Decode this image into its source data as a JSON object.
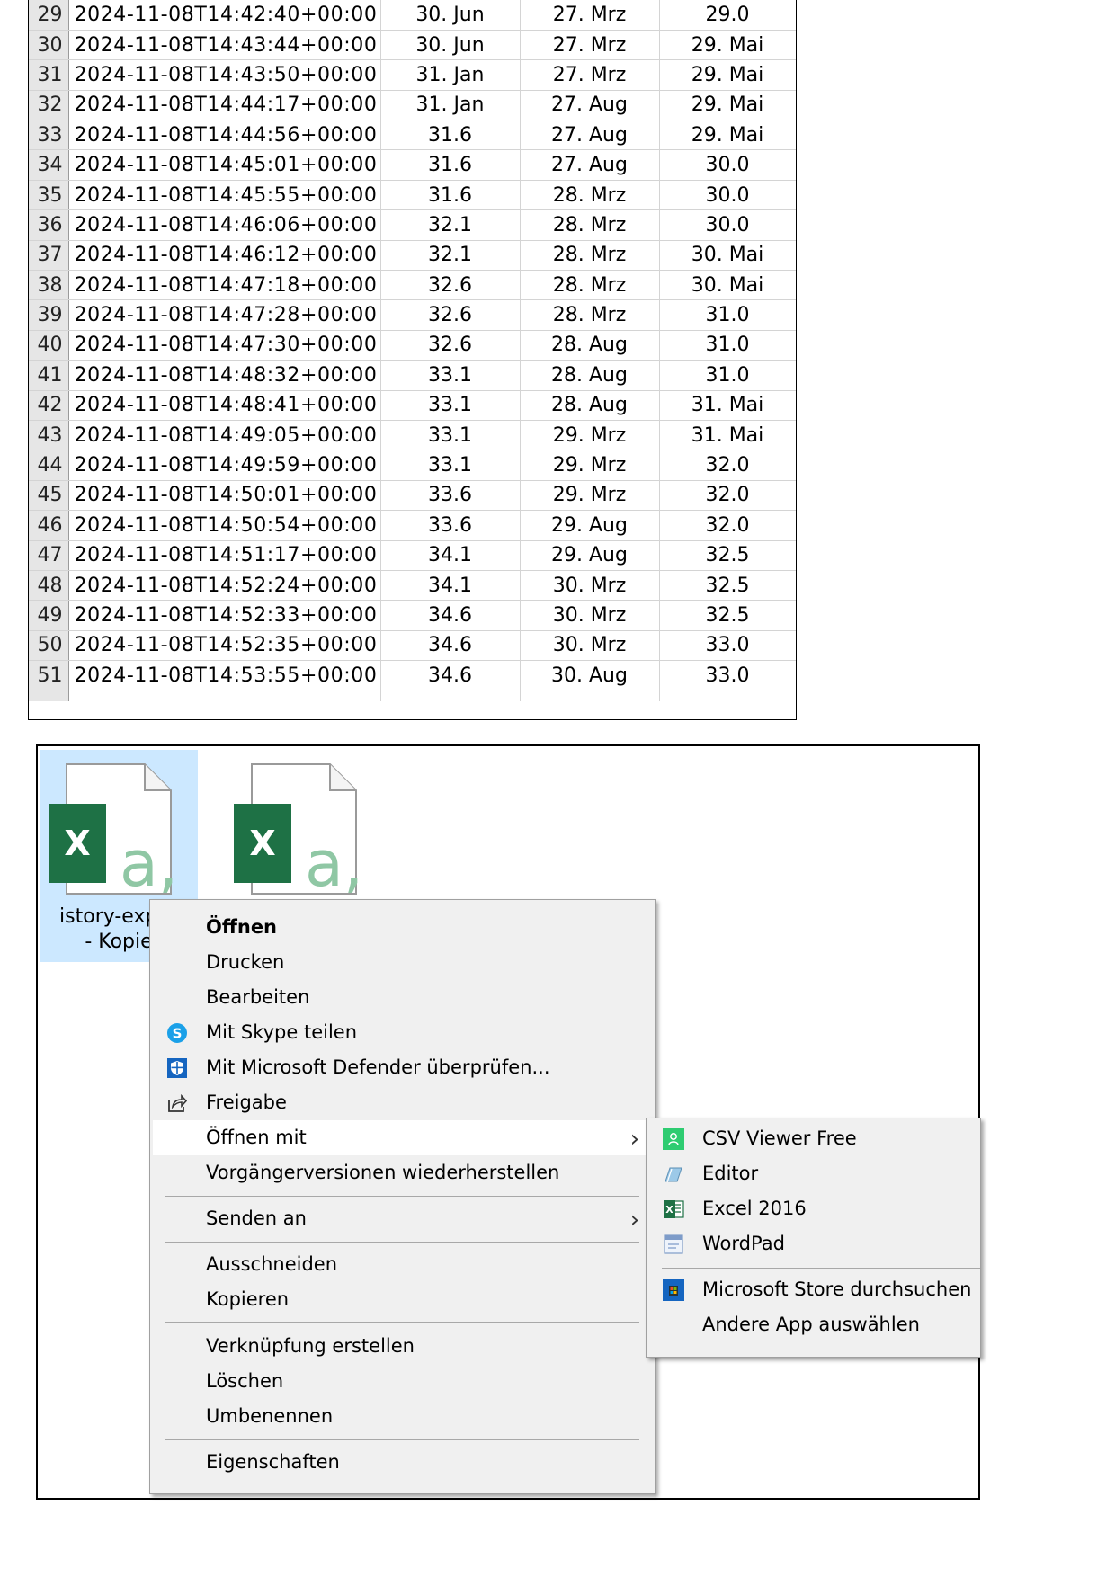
{
  "sheet": {
    "rows": [
      {
        "n": "29",
        "ts": "2024-11-08T14:42:40+00:00",
        "a": "30. Jun",
        "b": "27. Mrz",
        "c": "29.0"
      },
      {
        "n": "30",
        "ts": "2024-11-08T14:43:44+00:00",
        "a": "30. Jun",
        "b": "27. Mrz",
        "c": "29. Mai"
      },
      {
        "n": "31",
        "ts": "2024-11-08T14:43:50+00:00",
        "a": "31. Jan",
        "b": "27. Mrz",
        "c": "29. Mai"
      },
      {
        "n": "32",
        "ts": "2024-11-08T14:44:17+00:00",
        "a": "31. Jan",
        "b": "27. Aug",
        "c": "29. Mai"
      },
      {
        "n": "33",
        "ts": "2024-11-08T14:44:56+00:00",
        "a": "31.6",
        "b": "27. Aug",
        "c": "29. Mai"
      },
      {
        "n": "34",
        "ts": "2024-11-08T14:45:01+00:00",
        "a": "31.6",
        "b": "27. Aug",
        "c": "30.0"
      },
      {
        "n": "35",
        "ts": "2024-11-08T14:45:55+00:00",
        "a": "31.6",
        "b": "28. Mrz",
        "c": "30.0"
      },
      {
        "n": "36",
        "ts": "2024-11-08T14:46:06+00:00",
        "a": "32.1",
        "b": "28. Mrz",
        "c": "30.0"
      },
      {
        "n": "37",
        "ts": "2024-11-08T14:46:12+00:00",
        "a": "32.1",
        "b": "28. Mrz",
        "c": "30. Mai"
      },
      {
        "n": "38",
        "ts": "2024-11-08T14:47:18+00:00",
        "a": "32.6",
        "b": "28. Mrz",
        "c": "30. Mai"
      },
      {
        "n": "39",
        "ts": "2024-11-08T14:47:28+00:00",
        "a": "32.6",
        "b": "28. Mrz",
        "c": "31.0"
      },
      {
        "n": "40",
        "ts": "2024-11-08T14:47:30+00:00",
        "a": "32.6",
        "b": "28. Aug",
        "c": "31.0"
      },
      {
        "n": "41",
        "ts": "2024-11-08T14:48:32+00:00",
        "a": "33.1",
        "b": "28. Aug",
        "c": "31.0"
      },
      {
        "n": "42",
        "ts": "2024-11-08T14:48:41+00:00",
        "a": "33.1",
        "b": "28. Aug",
        "c": "31. Mai"
      },
      {
        "n": "43",
        "ts": "2024-11-08T14:49:05+00:00",
        "a": "33.1",
        "b": "29. Mrz",
        "c": "31. Mai"
      },
      {
        "n": "44",
        "ts": "2024-11-08T14:49:59+00:00",
        "a": "33.1",
        "b": "29. Mrz",
        "c": "32.0"
      },
      {
        "n": "45",
        "ts": "2024-11-08T14:50:01+00:00",
        "a": "33.6",
        "b": "29. Mrz",
        "c": "32.0"
      },
      {
        "n": "46",
        "ts": "2024-11-08T14:50:54+00:00",
        "a": "33.6",
        "b": "29. Aug",
        "c": "32.0"
      },
      {
        "n": "47",
        "ts": "2024-11-08T14:51:17+00:00",
        "a": "34.1",
        "b": "29. Aug",
        "c": "32.5"
      },
      {
        "n": "48",
        "ts": "2024-11-08T14:52:24+00:00",
        "a": "34.1",
        "b": "30. Mrz",
        "c": "32.5"
      },
      {
        "n": "49",
        "ts": "2024-11-08T14:52:33+00:00",
        "a": "34.6",
        "b": "30. Mrz",
        "c": "32.5"
      },
      {
        "n": "50",
        "ts": "2024-11-08T14:52:35+00:00",
        "a": "34.6",
        "b": "30. Mrz",
        "c": "33.0"
      },
      {
        "n": "51",
        "ts": "2024-11-08T14:53:55+00:00",
        "a": "34.6",
        "b": "30. Aug",
        "c": "33.0"
      }
    ]
  },
  "explorer": {
    "files": [
      {
        "name_line1": "istory-expor",
        "name_line2": "- Kopie",
        "icon": "excel-csv-file-icon",
        "tile_letter": "X",
        "overlay_letter": "a,"
      },
      {
        "icon": "excel-csv-file-icon",
        "tile_letter": "X",
        "overlay_letter": "a,"
      }
    ]
  },
  "context_menu": {
    "items": {
      "open": "Öffnen",
      "print": "Drucken",
      "edit": "Bearbeiten",
      "skype": "Mit Skype teilen",
      "defender": "Mit Microsoft Defender überprüfen...",
      "share": "Freigabe",
      "open_with": "Öffnen mit",
      "restore": "Vorgängerversionen wiederherstellen",
      "send_to": "Senden an",
      "cut": "Ausschneiden",
      "copy": "Kopieren",
      "shortcut": "Verknüpfung erstellen",
      "delete": "Löschen",
      "rename": "Umbenennen",
      "properties": "Eigenschaften"
    },
    "icons": {
      "skype": "skype-icon",
      "defender": "defender-shield-icon",
      "share": "share-icon",
      "submenu": "chevron-right-icon"
    },
    "colors": {
      "menu_bg": "#f0f0f0",
      "highlight": "#ffffff",
      "selection": "#cce8ff",
      "excel_green": "#1e7145"
    }
  },
  "open_with_menu": {
    "items": {
      "csv_viewer": "CSV Viewer Free",
      "editor": "Editor",
      "excel": "Excel 2016",
      "wordpad": "WordPad",
      "store": "Microsoft Store durchsuchen",
      "other": "Andere App auswählen"
    }
  }
}
